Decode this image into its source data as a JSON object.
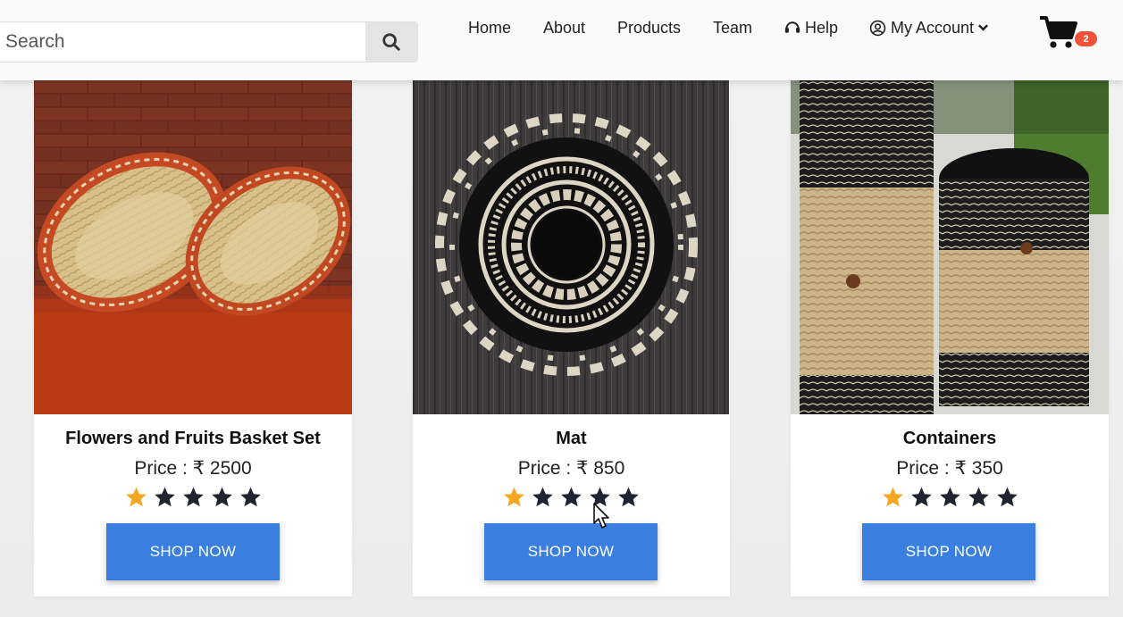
{
  "header": {
    "search": {
      "placeholder": "Search",
      "value": ""
    },
    "nav": [
      {
        "label": "Home"
      },
      {
        "label": "About"
      },
      {
        "label": "Products"
      },
      {
        "label": "Team"
      },
      {
        "label": "Help",
        "icon": "headset-icon"
      },
      {
        "label": "My Account",
        "icon": "user-circle-icon",
        "dropdown": true
      }
    ],
    "cart": {
      "count": "2",
      "icon": "shopping-cart-icon"
    }
  },
  "products": [
    {
      "title": "Flowers and Fruits Basket Set",
      "price": "Price : ₹ 2500",
      "rating": 1,
      "max_rating": 5,
      "button": "SHOP NOW"
    },
    {
      "title": "Mat",
      "price": "Price : ₹ 850",
      "rating": 1,
      "max_rating": 5,
      "button": "SHOP NOW"
    },
    {
      "title": "Containers",
      "price": "Price : ₹ 350",
      "rating": 1,
      "max_rating": 5,
      "button": "SHOP NOW"
    }
  ],
  "colors": {
    "accent": "#3a7fe0",
    "badge": "#f0533a",
    "star_filled": "#f5a623",
    "star_empty": "#1f2530"
  }
}
